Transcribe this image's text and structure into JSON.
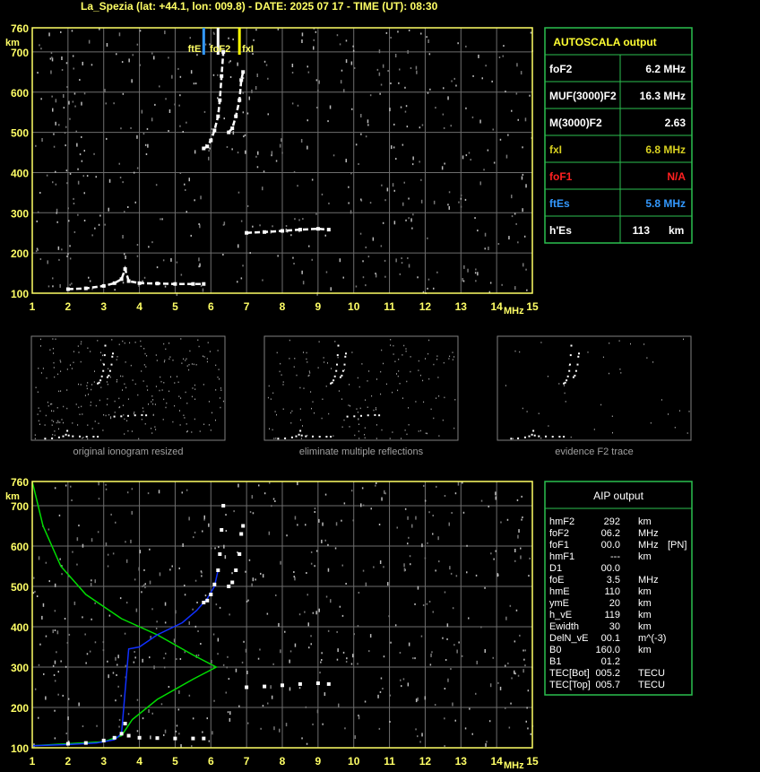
{
  "header": "La_Spezia (lat: +44.1, lon: 009.8) - DATE: 2025 07 17 - TIME (UT): 08:30",
  "thumb_captions": [
    "original ionogram resized",
    "eliminate multiple reflections",
    "evidence F2 trace"
  ],
  "autoscala": {
    "title": "AUTOSCALA output",
    "rows": [
      {
        "label": "foF2",
        "value": "6.2 MHz",
        "color": "#ffffff"
      },
      {
        "label": "MUF(3000)F2",
        "value": "16.3 MHz",
        "color": "#ffffff"
      },
      {
        "label": "M(3000)F2",
        "value": "2.63",
        "color": "#ffffff"
      },
      {
        "label": "fxI",
        "value": "6.8 MHz",
        "color": "#d8d020"
      },
      {
        "label": "foF1",
        "value": "N/A",
        "color": "#ff2020"
      },
      {
        "label": "ftEs",
        "value": "5.8 MHz",
        "color": "#3399ff"
      },
      {
        "label": "h'Es",
        "value": "113",
        "unit": "km",
        "color": "#ffffff"
      }
    ]
  },
  "aip": {
    "title": "AIP output",
    "rows": [
      [
        "hmF2",
        "292",
        "km",
        ""
      ],
      [
        "foF2",
        "06.2",
        "MHz",
        ""
      ],
      [
        "foF1",
        "00.0",
        "MHz",
        "[PN]"
      ],
      [
        "hmF1",
        "---",
        "km",
        ""
      ],
      [
        "D1",
        "00.0",
        "",
        ""
      ],
      [
        "foE",
        "3.5",
        "MHz",
        ""
      ],
      [
        "hmE",
        "110",
        "km",
        ""
      ],
      [
        "ymE",
        "20",
        "km",
        ""
      ],
      [
        "h_vE",
        "119",
        "km",
        ""
      ],
      [
        "Ewidth",
        "30",
        "km",
        ""
      ],
      [
        "DelN_vE",
        "00.1",
        "m^(-3)",
        ""
      ],
      [
        "B0",
        "160.0",
        "km",
        ""
      ],
      [
        "B1",
        "01.2",
        "",
        ""
      ],
      [
        "TEC[Bot]",
        "005.2",
        "TECU",
        ""
      ],
      [
        "TEC[Top]",
        "005.7",
        "TECU",
        ""
      ]
    ]
  },
  "markers": [
    {
      "label": "ftE",
      "x": 5.8,
      "color": "#3399ff"
    },
    {
      "label": "foF2",
      "x": 6.2,
      "color": "#ffffff"
    },
    {
      "label": "fxI",
      "x": 6.8,
      "color": "#ffff00"
    }
  ],
  "chart_data": [
    {
      "type": "scatter",
      "title": "",
      "xlabel": "MHz",
      "ylabel": "km",
      "xlim": [
        1,
        15
      ],
      "ylim": [
        100,
        760
      ],
      "x_ticks": [
        1,
        2,
        3,
        4,
        5,
        6,
        7,
        8,
        9,
        10,
        11,
        12,
        13,
        14,
        15
      ],
      "y_ticks": [
        100,
        200,
        300,
        400,
        500,
        600,
        700,
        760
      ],
      "grid": true,
      "series": [
        {
          "role": "Es trace",
          "points": [
            [
              2.0,
              110
            ],
            [
              2.5,
              112
            ],
            [
              3.0,
              118
            ],
            [
              3.3,
              125
            ],
            [
              3.5,
              135
            ],
            [
              3.6,
              160
            ],
            [
              3.7,
              130
            ],
            [
              4.0,
              125
            ],
            [
              4.5,
              124
            ],
            [
              5.0,
              123
            ],
            [
              5.5,
              123
            ],
            [
              5.8,
              123
            ]
          ]
        },
        {
          "role": "F2 trace",
          "points": [
            [
              5.8,
              460
            ],
            [
              5.9,
              465
            ],
            [
              6.0,
              480
            ],
            [
              6.1,
              505
            ],
            [
              6.2,
              540
            ],
            [
              6.25,
              580
            ],
            [
              6.3,
              640
            ],
            [
              6.35,
              700
            ]
          ]
        },
        {
          "role": "x trace",
          "points": [
            [
              6.5,
              500
            ],
            [
              6.6,
              510
            ],
            [
              6.7,
              540
            ],
            [
              6.8,
              580
            ],
            [
              6.85,
              630
            ],
            [
              6.9,
              650
            ]
          ]
        },
        {
          "role": "multiple echo",
          "points": [
            [
              7.0,
              250
            ],
            [
              7.5,
              252
            ],
            [
              8.0,
              255
            ],
            [
              8.5,
              258
            ],
            [
              9.0,
              260
            ],
            [
              9.3,
              258
            ]
          ]
        }
      ]
    },
    {
      "type": "line",
      "title": "",
      "xlabel": "MHz",
      "ylabel": "km",
      "xlim": [
        1,
        15
      ],
      "ylim": [
        100,
        760
      ],
      "x_ticks": [
        1,
        2,
        3,
        4,
        5,
        6,
        7,
        8,
        9,
        10,
        11,
        12,
        13,
        14,
        15
      ],
      "y_ticks": [
        100,
        200,
        300,
        400,
        500,
        600,
        700,
        760
      ],
      "grid": true,
      "series": [
        {
          "role": "profile",
          "color": "#00dd00",
          "points": [
            [
              1.0,
              760
            ],
            [
              1.3,
              650
            ],
            [
              1.8,
              550
            ],
            [
              2.5,
              480
            ],
            [
              3.5,
              420
            ],
            [
              4.5,
              380
            ],
            [
              5.5,
              330
            ],
            [
              6.15,
              300
            ],
            [
              5.5,
              270
            ],
            [
              4.5,
              220
            ],
            [
              3.8,
              170
            ],
            [
              3.5,
              130
            ],
            [
              3.0,
              115
            ],
            [
              1.0,
              105
            ]
          ]
        },
        {
          "role": "trace fit",
          "color": "#1030ff",
          "points": [
            [
              1.0,
              105
            ],
            [
              2.0,
              108
            ],
            [
              2.8,
              112
            ],
            [
              3.3,
              120
            ],
            [
              3.5,
              135
            ],
            [
              3.7,
              345
            ],
            [
              4.0,
              350
            ],
            [
              4.5,
              380
            ],
            [
              5.2,
              410
            ],
            [
              5.6,
              440
            ],
            [
              5.9,
              470
            ],
            [
              6.1,
              500
            ],
            [
              6.2,
              540
            ]
          ]
        }
      ]
    }
  ]
}
